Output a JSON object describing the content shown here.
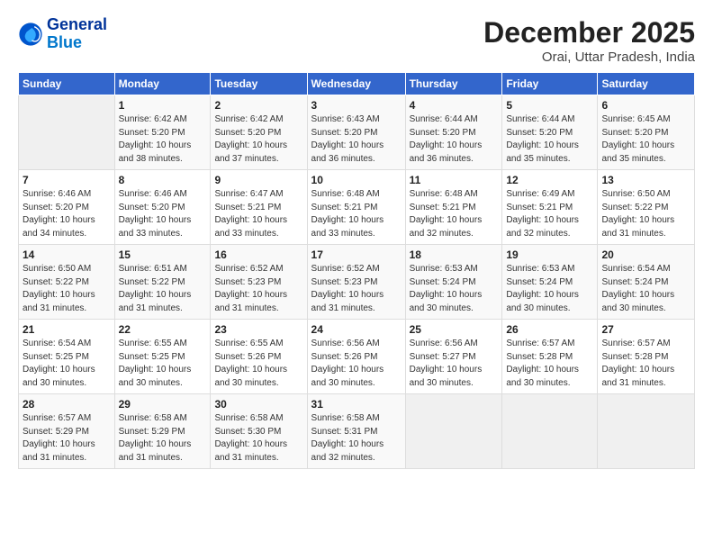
{
  "logo": {
    "line1": "General",
    "line2": "Blue"
  },
  "title": "December 2025",
  "subtitle": "Orai, Uttar Pradesh, India",
  "header": {
    "days": [
      "Sunday",
      "Monday",
      "Tuesday",
      "Wednesday",
      "Thursday",
      "Friday",
      "Saturday"
    ]
  },
  "weeks": [
    {
      "cells": [
        {
          "empty": true
        },
        {
          "day": "1",
          "sunrise": "6:42 AM",
          "sunset": "5:20 PM",
          "daylight": "10 hours and 38 minutes."
        },
        {
          "day": "2",
          "sunrise": "6:42 AM",
          "sunset": "5:20 PM",
          "daylight": "10 hours and 37 minutes."
        },
        {
          "day": "3",
          "sunrise": "6:43 AM",
          "sunset": "5:20 PM",
          "daylight": "10 hours and 36 minutes."
        },
        {
          "day": "4",
          "sunrise": "6:44 AM",
          "sunset": "5:20 PM",
          "daylight": "10 hours and 36 minutes."
        },
        {
          "day": "5",
          "sunrise": "6:44 AM",
          "sunset": "5:20 PM",
          "daylight": "10 hours and 35 minutes."
        },
        {
          "day": "6",
          "sunrise": "6:45 AM",
          "sunset": "5:20 PM",
          "daylight": "10 hours and 35 minutes."
        }
      ]
    },
    {
      "cells": [
        {
          "day": "7",
          "sunrise": "6:46 AM",
          "sunset": "5:20 PM",
          "daylight": "10 hours and 34 minutes."
        },
        {
          "day": "8",
          "sunrise": "6:46 AM",
          "sunset": "5:20 PM",
          "daylight": "10 hours and 33 minutes."
        },
        {
          "day": "9",
          "sunrise": "6:47 AM",
          "sunset": "5:21 PM",
          "daylight": "10 hours and 33 minutes."
        },
        {
          "day": "10",
          "sunrise": "6:48 AM",
          "sunset": "5:21 PM",
          "daylight": "10 hours and 33 minutes."
        },
        {
          "day": "11",
          "sunrise": "6:48 AM",
          "sunset": "5:21 PM",
          "daylight": "10 hours and 32 minutes."
        },
        {
          "day": "12",
          "sunrise": "6:49 AM",
          "sunset": "5:21 PM",
          "daylight": "10 hours and 32 minutes."
        },
        {
          "day": "13",
          "sunrise": "6:50 AM",
          "sunset": "5:22 PM",
          "daylight": "10 hours and 31 minutes."
        }
      ]
    },
    {
      "cells": [
        {
          "day": "14",
          "sunrise": "6:50 AM",
          "sunset": "5:22 PM",
          "daylight": "10 hours and 31 minutes."
        },
        {
          "day": "15",
          "sunrise": "6:51 AM",
          "sunset": "5:22 PM",
          "daylight": "10 hours and 31 minutes."
        },
        {
          "day": "16",
          "sunrise": "6:52 AM",
          "sunset": "5:23 PM",
          "daylight": "10 hours and 31 minutes."
        },
        {
          "day": "17",
          "sunrise": "6:52 AM",
          "sunset": "5:23 PM",
          "daylight": "10 hours and 31 minutes."
        },
        {
          "day": "18",
          "sunrise": "6:53 AM",
          "sunset": "5:24 PM",
          "daylight": "10 hours and 30 minutes."
        },
        {
          "day": "19",
          "sunrise": "6:53 AM",
          "sunset": "5:24 PM",
          "daylight": "10 hours and 30 minutes."
        },
        {
          "day": "20",
          "sunrise": "6:54 AM",
          "sunset": "5:24 PM",
          "daylight": "10 hours and 30 minutes."
        }
      ]
    },
    {
      "cells": [
        {
          "day": "21",
          "sunrise": "6:54 AM",
          "sunset": "5:25 PM",
          "daylight": "10 hours and 30 minutes."
        },
        {
          "day": "22",
          "sunrise": "6:55 AM",
          "sunset": "5:25 PM",
          "daylight": "10 hours and 30 minutes."
        },
        {
          "day": "23",
          "sunrise": "6:55 AM",
          "sunset": "5:26 PM",
          "daylight": "10 hours and 30 minutes."
        },
        {
          "day": "24",
          "sunrise": "6:56 AM",
          "sunset": "5:26 PM",
          "daylight": "10 hours and 30 minutes."
        },
        {
          "day": "25",
          "sunrise": "6:56 AM",
          "sunset": "5:27 PM",
          "daylight": "10 hours and 30 minutes."
        },
        {
          "day": "26",
          "sunrise": "6:57 AM",
          "sunset": "5:28 PM",
          "daylight": "10 hours and 30 minutes."
        },
        {
          "day": "27",
          "sunrise": "6:57 AM",
          "sunset": "5:28 PM",
          "daylight": "10 hours and 31 minutes."
        }
      ]
    },
    {
      "cells": [
        {
          "day": "28",
          "sunrise": "6:57 AM",
          "sunset": "5:29 PM",
          "daylight": "10 hours and 31 minutes."
        },
        {
          "day": "29",
          "sunrise": "6:58 AM",
          "sunset": "5:29 PM",
          "daylight": "10 hours and 31 minutes."
        },
        {
          "day": "30",
          "sunrise": "6:58 AM",
          "sunset": "5:30 PM",
          "daylight": "10 hours and 31 minutes."
        },
        {
          "day": "31",
          "sunrise": "6:58 AM",
          "sunset": "5:31 PM",
          "daylight": "10 hours and 32 minutes."
        },
        {
          "empty": true
        },
        {
          "empty": true
        },
        {
          "empty": true
        }
      ]
    }
  ],
  "labels": {
    "sunrise": "Sunrise:",
    "sunset": "Sunset:",
    "daylight": "Daylight:"
  }
}
